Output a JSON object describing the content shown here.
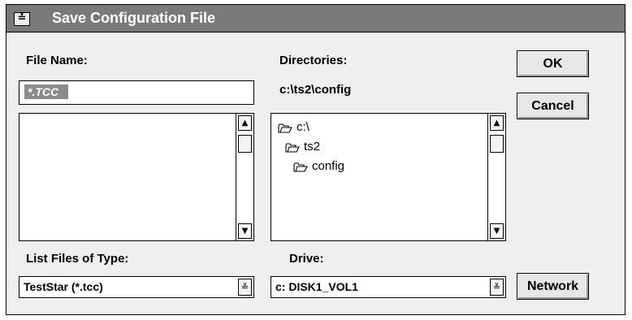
{
  "dialog": {
    "title": "Save Configuration File",
    "system_menu_glyph": "≚"
  },
  "file_name": {
    "label": "File Name:",
    "value": "*.TCC",
    "files": []
  },
  "directories": {
    "label": "Directories:",
    "current_path": "c:\\ts2\\config",
    "tree": [
      {
        "name": "c:\\",
        "icon": "open-folder-icon"
      },
      {
        "name": "ts2",
        "icon": "open-folder-icon"
      },
      {
        "name": "config",
        "icon": "open-folder-icon"
      }
    ]
  },
  "file_type": {
    "label": "List Files of Type:",
    "selected": "TestStar (*.tcc)"
  },
  "drive": {
    "label": "Drive:",
    "selected": "c: DISK1_VOL1"
  },
  "buttons": {
    "ok": "OK",
    "cancel": "Cancel",
    "network": "Network"
  },
  "scroll": {
    "up_glyph": "▲",
    "down_glyph": "▼",
    "combo_glyph": "≚"
  },
  "colors": {
    "titlebar": "#7a7a7a",
    "dialog_bg": "#efefef",
    "selection": "#8c8c8c"
  }
}
